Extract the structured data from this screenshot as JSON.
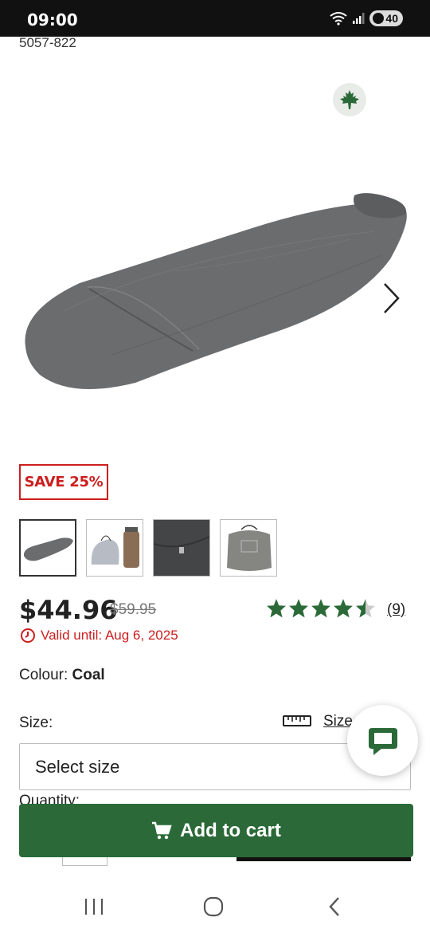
{
  "status_bar": {
    "time": "09:00",
    "battery": "40"
  },
  "product": {
    "sku": "5057-822",
    "save_badge": "SAVE 25%",
    "price": "$44.96",
    "old_price": "$59.95",
    "rating": 4.5,
    "rating_count": "(9)",
    "valid_until": "Valid until: Aug 6, 2025",
    "colour_label": "Colour:",
    "colour_value": "Coal",
    "size_label": "Size:",
    "size_guide_link": "Size",
    "size_select_value": "Select size",
    "quantity_label": "Quantity:",
    "add_to_cart_label": "Add to cart"
  },
  "colors": {
    "brand_green": "#2b6a38",
    "sale_red": "#cc1f1f",
    "product_grey": "#6b6c6e"
  },
  "icons": {
    "maple": "maple-leaf-icon",
    "next": "chevron-right-icon",
    "clock": "clock-icon",
    "ruler": "ruler-icon",
    "cart": "cart-icon",
    "chat": "chat-icon"
  }
}
